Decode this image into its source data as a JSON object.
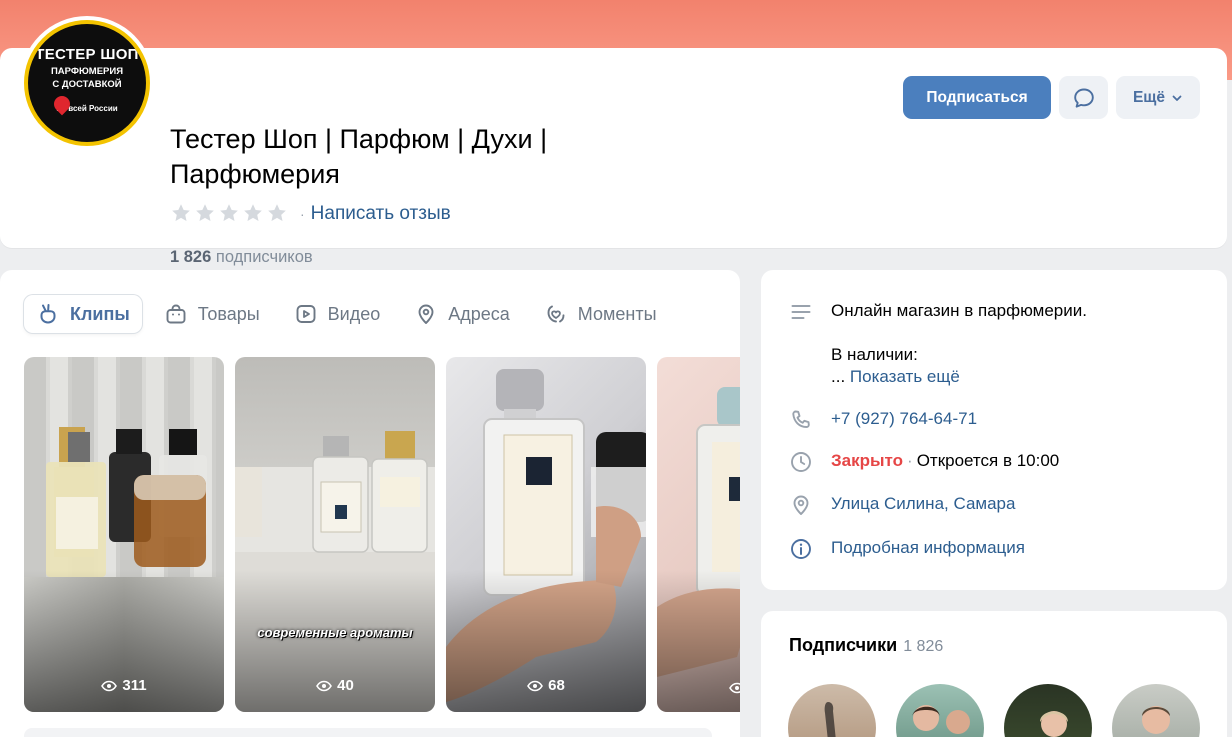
{
  "group": {
    "avatar_lines": [
      "ТЕСТЕР ШОП",
      "ПАРФЮМЕРИЯ",
      "С ДОСТАВКОЙ",
      "по всей России"
    ],
    "title": "Тестер Шоп | Парфюм | Духи | Парфюмерия",
    "rating_stars": 5,
    "review_link": "Написать отзыв",
    "subscribers_number": "1 826",
    "subscribers_label": "подписчиков"
  },
  "actions": {
    "subscribe": "Подписаться",
    "more": "Ещё"
  },
  "tabs": [
    {
      "label": "Клипы",
      "icon": "clips-icon",
      "active": true
    },
    {
      "label": "Товары",
      "icon": "bag-icon",
      "active": false
    },
    {
      "label": "Видео",
      "icon": "video-icon",
      "active": false
    },
    {
      "label": "Адреса",
      "icon": "location-pin-icon",
      "active": false
    },
    {
      "label": "Моменты",
      "icon": "moments-icon",
      "active": false
    }
  ],
  "clips": [
    {
      "views": "311",
      "caption": ""
    },
    {
      "views": "40",
      "caption": "современные ароматы"
    },
    {
      "views": "68",
      "caption": ""
    },
    {
      "views": "",
      "caption": ""
    }
  ],
  "info": {
    "description_line1": "Онлайн магазин в парфюмерии.",
    "description_line2": "В наличии:",
    "ellipsis": "...",
    "show_more": "Показать ещё",
    "phone": "+7 (927) 764-64-71",
    "status_closed": "Закрыто",
    "status_opens": "Откроется в 10:00",
    "address": "Улица Силина, Самара",
    "details": "Подробная информация"
  },
  "subscribers_block": {
    "title": "Подписчики",
    "count": "1 826"
  },
  "colors": {
    "accent": "#4b7fbe",
    "link": "#2c5d8f",
    "closed": "#e64646",
    "cover_top": "#f2826d",
    "background": "#edeef0"
  }
}
